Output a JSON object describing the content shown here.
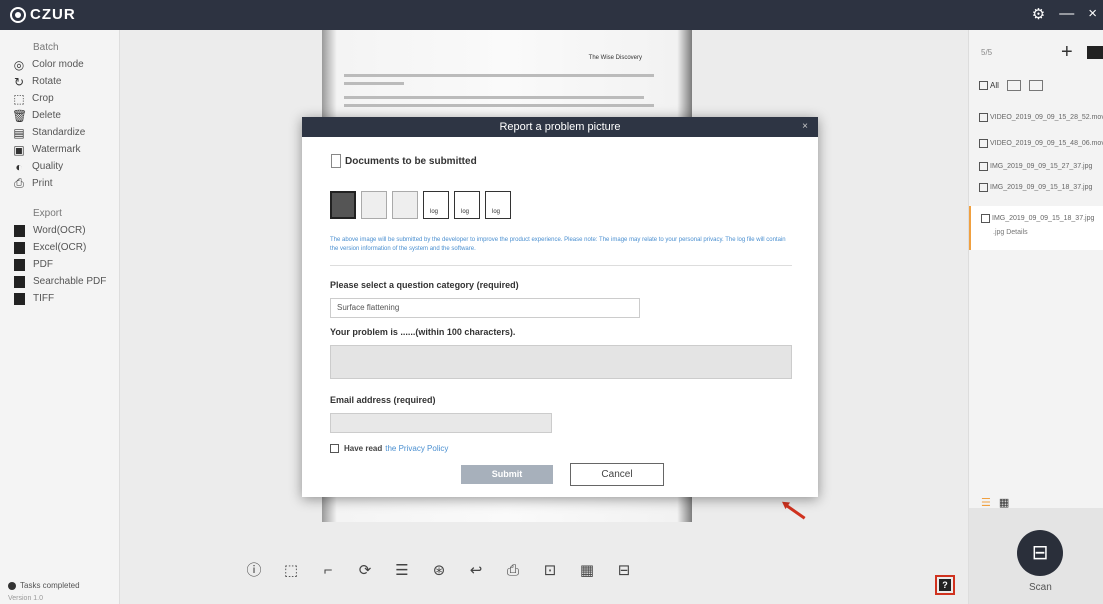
{
  "app": {
    "brand": "CZUR",
    "controls": [
      "⚙",
      "—",
      "×"
    ]
  },
  "left_panel": {
    "batch_title": "Batch",
    "batch_items": [
      {
        "icon": "color-mode-icon",
        "glyph": "◎",
        "label": "Color mode"
      },
      {
        "icon": "rotate-icon",
        "glyph": "↻",
        "label": "Rotate"
      },
      {
        "icon": "crop-icon",
        "glyph": "⬚",
        "label": "Crop"
      },
      {
        "icon": "delete-icon",
        "glyph": "🗑",
        "label": "Delete"
      },
      {
        "icon": "standardize-icon",
        "glyph": "▤",
        "label": "Standardize"
      },
      {
        "icon": "watermark-icon",
        "glyph": "▣",
        "label": "Watermark"
      },
      {
        "icon": "quality-icon",
        "glyph": "◐",
        "label": "Quality"
      },
      {
        "icon": "print-icon",
        "glyph": "⎙",
        "label": "Print"
      }
    ],
    "export_title": "Export",
    "export_items": [
      {
        "icon": "word-icon",
        "label": "Word(OCR)"
      },
      {
        "icon": "excel-icon",
        "label": "Excel(OCR)"
      },
      {
        "icon": "pdf-icon",
        "label": "PDF"
      },
      {
        "icon": "searchable-pdf-icon",
        "label": "Searchable PDF"
      },
      {
        "icon": "tiff-icon",
        "label": "TIFF"
      }
    ],
    "status": "Tasks completed",
    "version": "Version 1.0"
  },
  "document": {
    "header": "The Wise Discovery"
  },
  "bottom_toolbar": [
    {
      "name": "info-tool-icon",
      "glyph": "ⓘ"
    },
    {
      "name": "select-tool-icon",
      "glyph": "⬚"
    },
    {
      "name": "crop-tool-icon",
      "glyph": "⌐"
    },
    {
      "name": "rotate-tool-icon",
      "glyph": "⟳"
    },
    {
      "name": "flatten-tool-icon",
      "glyph": "☰"
    },
    {
      "name": "color-tool-icon",
      "glyph": "⊛"
    },
    {
      "name": "undo-tool-icon",
      "glyph": "↩"
    },
    {
      "name": "print-tool-icon",
      "glyph": "⎙"
    },
    {
      "name": "ocr-tool-icon",
      "glyph": "⊡"
    },
    {
      "name": "grid-tool-icon",
      "glyph": "▦"
    },
    {
      "name": "compare-tool-icon",
      "glyph": "⊟"
    }
  ],
  "right_panel": {
    "count": "5/5",
    "all_label": "All",
    "files": [
      {
        "name": "VIDEO_2019_09_09_15_28_52.mov",
        "meta": ""
      },
      {
        "name": "VIDEO_2019_09_09_15_48_06.mov",
        "meta": ""
      },
      {
        "name": "IMG_2019_09_09_15_27_37.jpg",
        "meta": ""
      },
      {
        "name": "IMG_2019_09_09_15_18_37.jpg",
        "meta": ""
      },
      {
        "name": "IMG_2019_09_09_15_18_37.jpg",
        "meta": ".jpg  Details"
      }
    ],
    "scan_label": "Scan"
  },
  "dialog": {
    "title": "Report a problem picture",
    "close": "×",
    "documents_title": "Documents to be submitted",
    "note": "The above image will be submitted by the developer to improve the product experience. Please note: The image may relate to your personal privacy. The log file will contain the version information of the system and the software.",
    "category_label": "Please select a question category (required)",
    "category_value": "Surface flattening",
    "problem_label": "Your problem is ......(within 100 characters).",
    "email_label": "Email address (required)",
    "email_value": "",
    "agree_text": "Have read",
    "privacy_link": "the Privacy Policy",
    "submit": "Submit",
    "cancel": "Cancel"
  },
  "colors": {
    "titlebar": "#2d3341",
    "accent": "#4a8fd0",
    "highlight": "#d0321f",
    "active_file": "#f0a040"
  }
}
